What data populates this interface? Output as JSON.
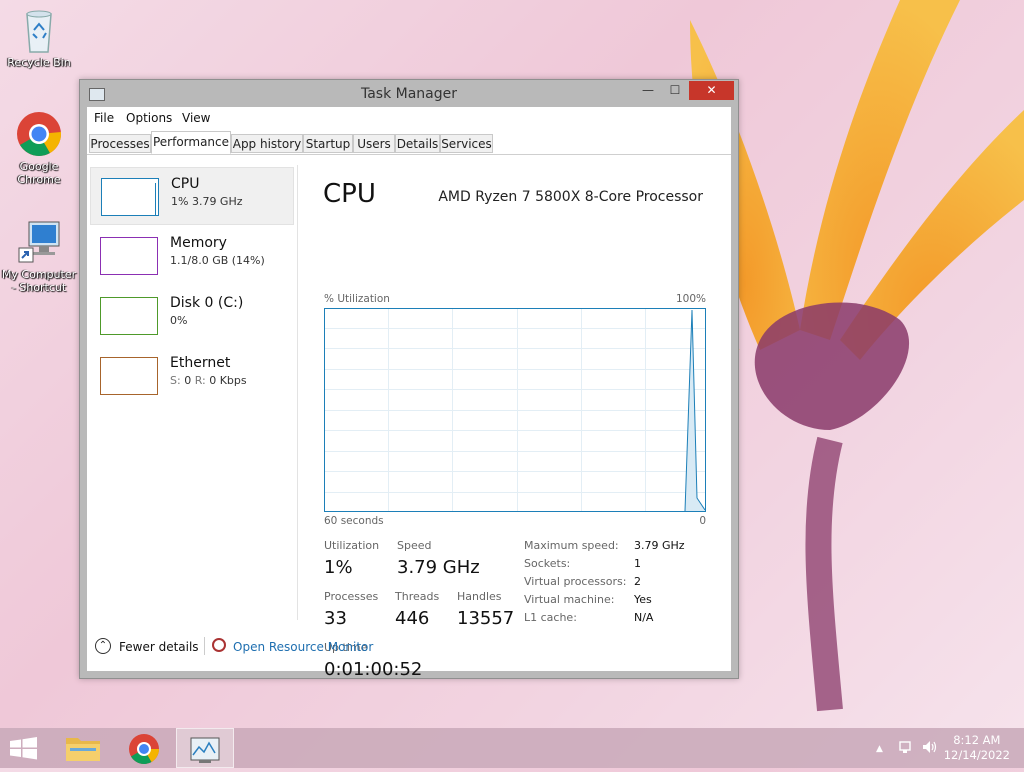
{
  "desktop": {
    "icons": [
      {
        "label": "Recycle Bin"
      },
      {
        "label": "Google Chrome"
      },
      {
        "label": "My Computer - Shortcut"
      }
    ]
  },
  "window": {
    "title": "Task Manager",
    "controls": {
      "minimize": "—",
      "maximize": "☐",
      "close": "✕"
    },
    "menu": [
      "File",
      "Options",
      "View"
    ],
    "tabs": [
      "Processes",
      "Performance",
      "App history",
      "Startup",
      "Users",
      "Details",
      "Services"
    ],
    "active_tab": "Performance"
  },
  "sidebar": {
    "items": [
      {
        "title": "CPU",
        "subtitle": "1% 3.79 GHz",
        "color": "#1c7fb8"
      },
      {
        "title": "Memory",
        "subtitle": "1.1/8.0 GB (14%)",
        "color": "#8b2fb3"
      },
      {
        "title": "Disk 0 (C:)",
        "subtitle": "0%",
        "color": "#4e9a2a"
      },
      {
        "title": "Ethernet",
        "subtitle_s": "S:",
        "subtitle_s_val": "0",
        "subtitle_r": "R:",
        "subtitle_r_val": "0 Kbps",
        "color": "#a7642c"
      }
    ]
  },
  "cpu": {
    "heading": "CPU",
    "processor": "AMD Ryzen 7 5800X 8-Core Processor",
    "utilization_label": "% Utilization",
    "max_label": "100%",
    "time_label": "60 seconds",
    "min_label": "0",
    "stats": {
      "utilization_label": "Utilization",
      "utilization": "1%",
      "speed_label": "Speed",
      "speed": "3.79 GHz",
      "processes_label": "Processes",
      "processes": "33",
      "threads_label": "Threads",
      "threads": "446",
      "handles_label": "Handles",
      "handles": "13557",
      "uptime_label": "Up time",
      "uptime": "0:01:00:52"
    },
    "specs": [
      {
        "label": "Maximum speed:",
        "value": "3.79 GHz"
      },
      {
        "label": "Sockets:",
        "value": "1"
      },
      {
        "label": "Virtual processors:",
        "value": "2"
      },
      {
        "label": "Virtual machine:",
        "value": "Yes"
      },
      {
        "label": "L1 cache:",
        "value": "N/A"
      }
    ]
  },
  "footer": {
    "fewer_details": "Fewer details",
    "open_resource_monitor": "Open Resource Monitor"
  },
  "taskbar": {
    "clock_time": "8:12 AM",
    "clock_date": "12/14/2022"
  }
}
